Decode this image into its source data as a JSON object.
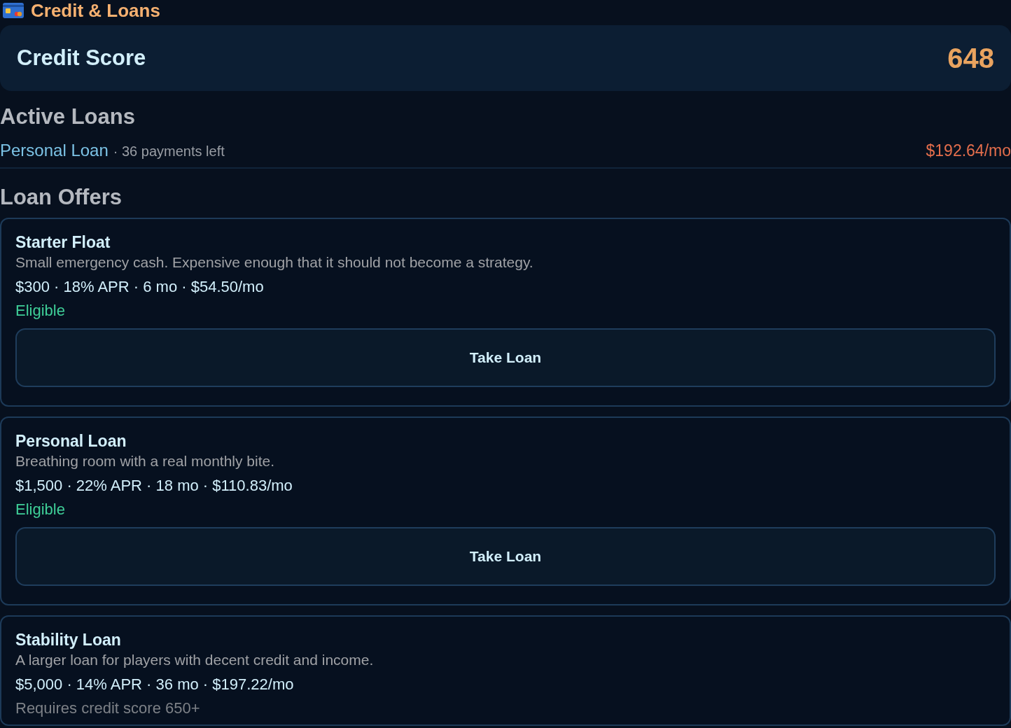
{
  "header": {
    "title": "Credit & Loans"
  },
  "credit_score": {
    "label": "Credit Score",
    "value": "648"
  },
  "active_loans": {
    "title": "Active Loans",
    "items": [
      {
        "name": "Personal Loan",
        "detail": "· 36 payments left",
        "payment": "$192.64/mo"
      }
    ]
  },
  "loan_offers": {
    "title": "Loan Offers",
    "items": [
      {
        "name": "Starter Float",
        "description": "Small emergency cash. Expensive enough that it should not become a strategy.",
        "terms": "$300 · 18% APR · 6 mo · $54.50/mo",
        "eligible": true,
        "status": "Eligible",
        "button": "Take Loan"
      },
      {
        "name": "Personal Loan",
        "description": "Breathing room with a real monthly bite.",
        "terms": "$1,500 · 22% APR · 18 mo · $110.83/mo",
        "eligible": true,
        "status": "Eligible",
        "button": "Take Loan"
      },
      {
        "name": "Stability Loan",
        "description": "A larger loan for players with decent credit and income.",
        "terms": "$5,000 · 14% APR · 36 mo · $197.22/mo",
        "eligible": false,
        "status": "Requires credit score 650+"
      }
    ]
  }
}
